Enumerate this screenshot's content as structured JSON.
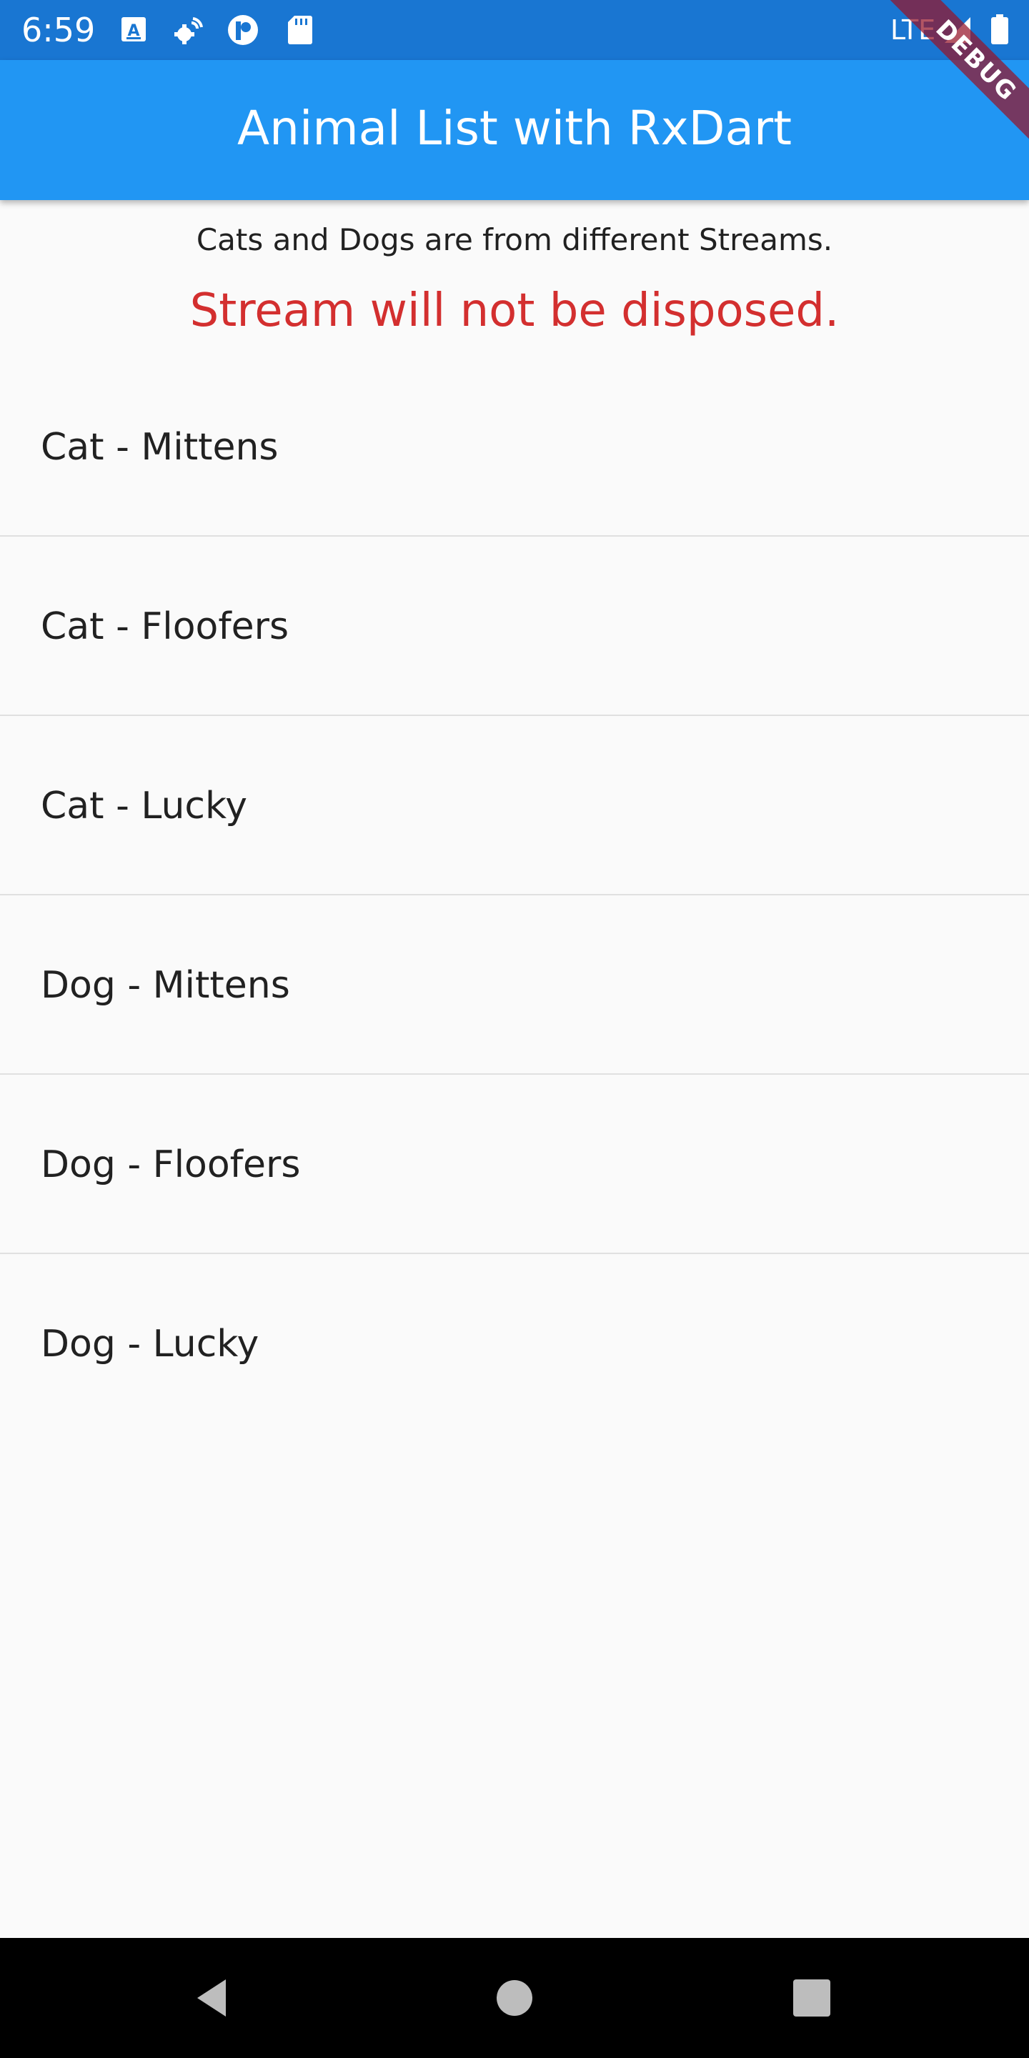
{
  "status_bar": {
    "time": "6:59",
    "network": "LTE",
    "icons": [
      "keyboard-a-icon",
      "settings-cog-icon",
      "pocket-casts-icon",
      "sd-card-icon",
      "signal-icon",
      "battery-icon"
    ],
    "color": "#1976d2"
  },
  "debug_banner": {
    "label": "DEBUG"
  },
  "app_bar": {
    "title": "Animal List with RxDart",
    "color": "#2196f3"
  },
  "content": {
    "subtitle": "Cats and Dogs are from different Streams.",
    "warning": "Stream will not be disposed.",
    "warning_color": "#d32f2f"
  },
  "animals": [
    {
      "label": "Cat - Mittens"
    },
    {
      "label": "Cat - Floofers"
    },
    {
      "label": "Cat - Lucky"
    },
    {
      "label": "Dog - Mittens"
    },
    {
      "label": "Dog - Floofers"
    },
    {
      "label": "Dog - Lucky"
    }
  ],
  "nav_bar": {
    "buttons": [
      "back-icon",
      "home-icon",
      "recents-icon"
    ]
  }
}
